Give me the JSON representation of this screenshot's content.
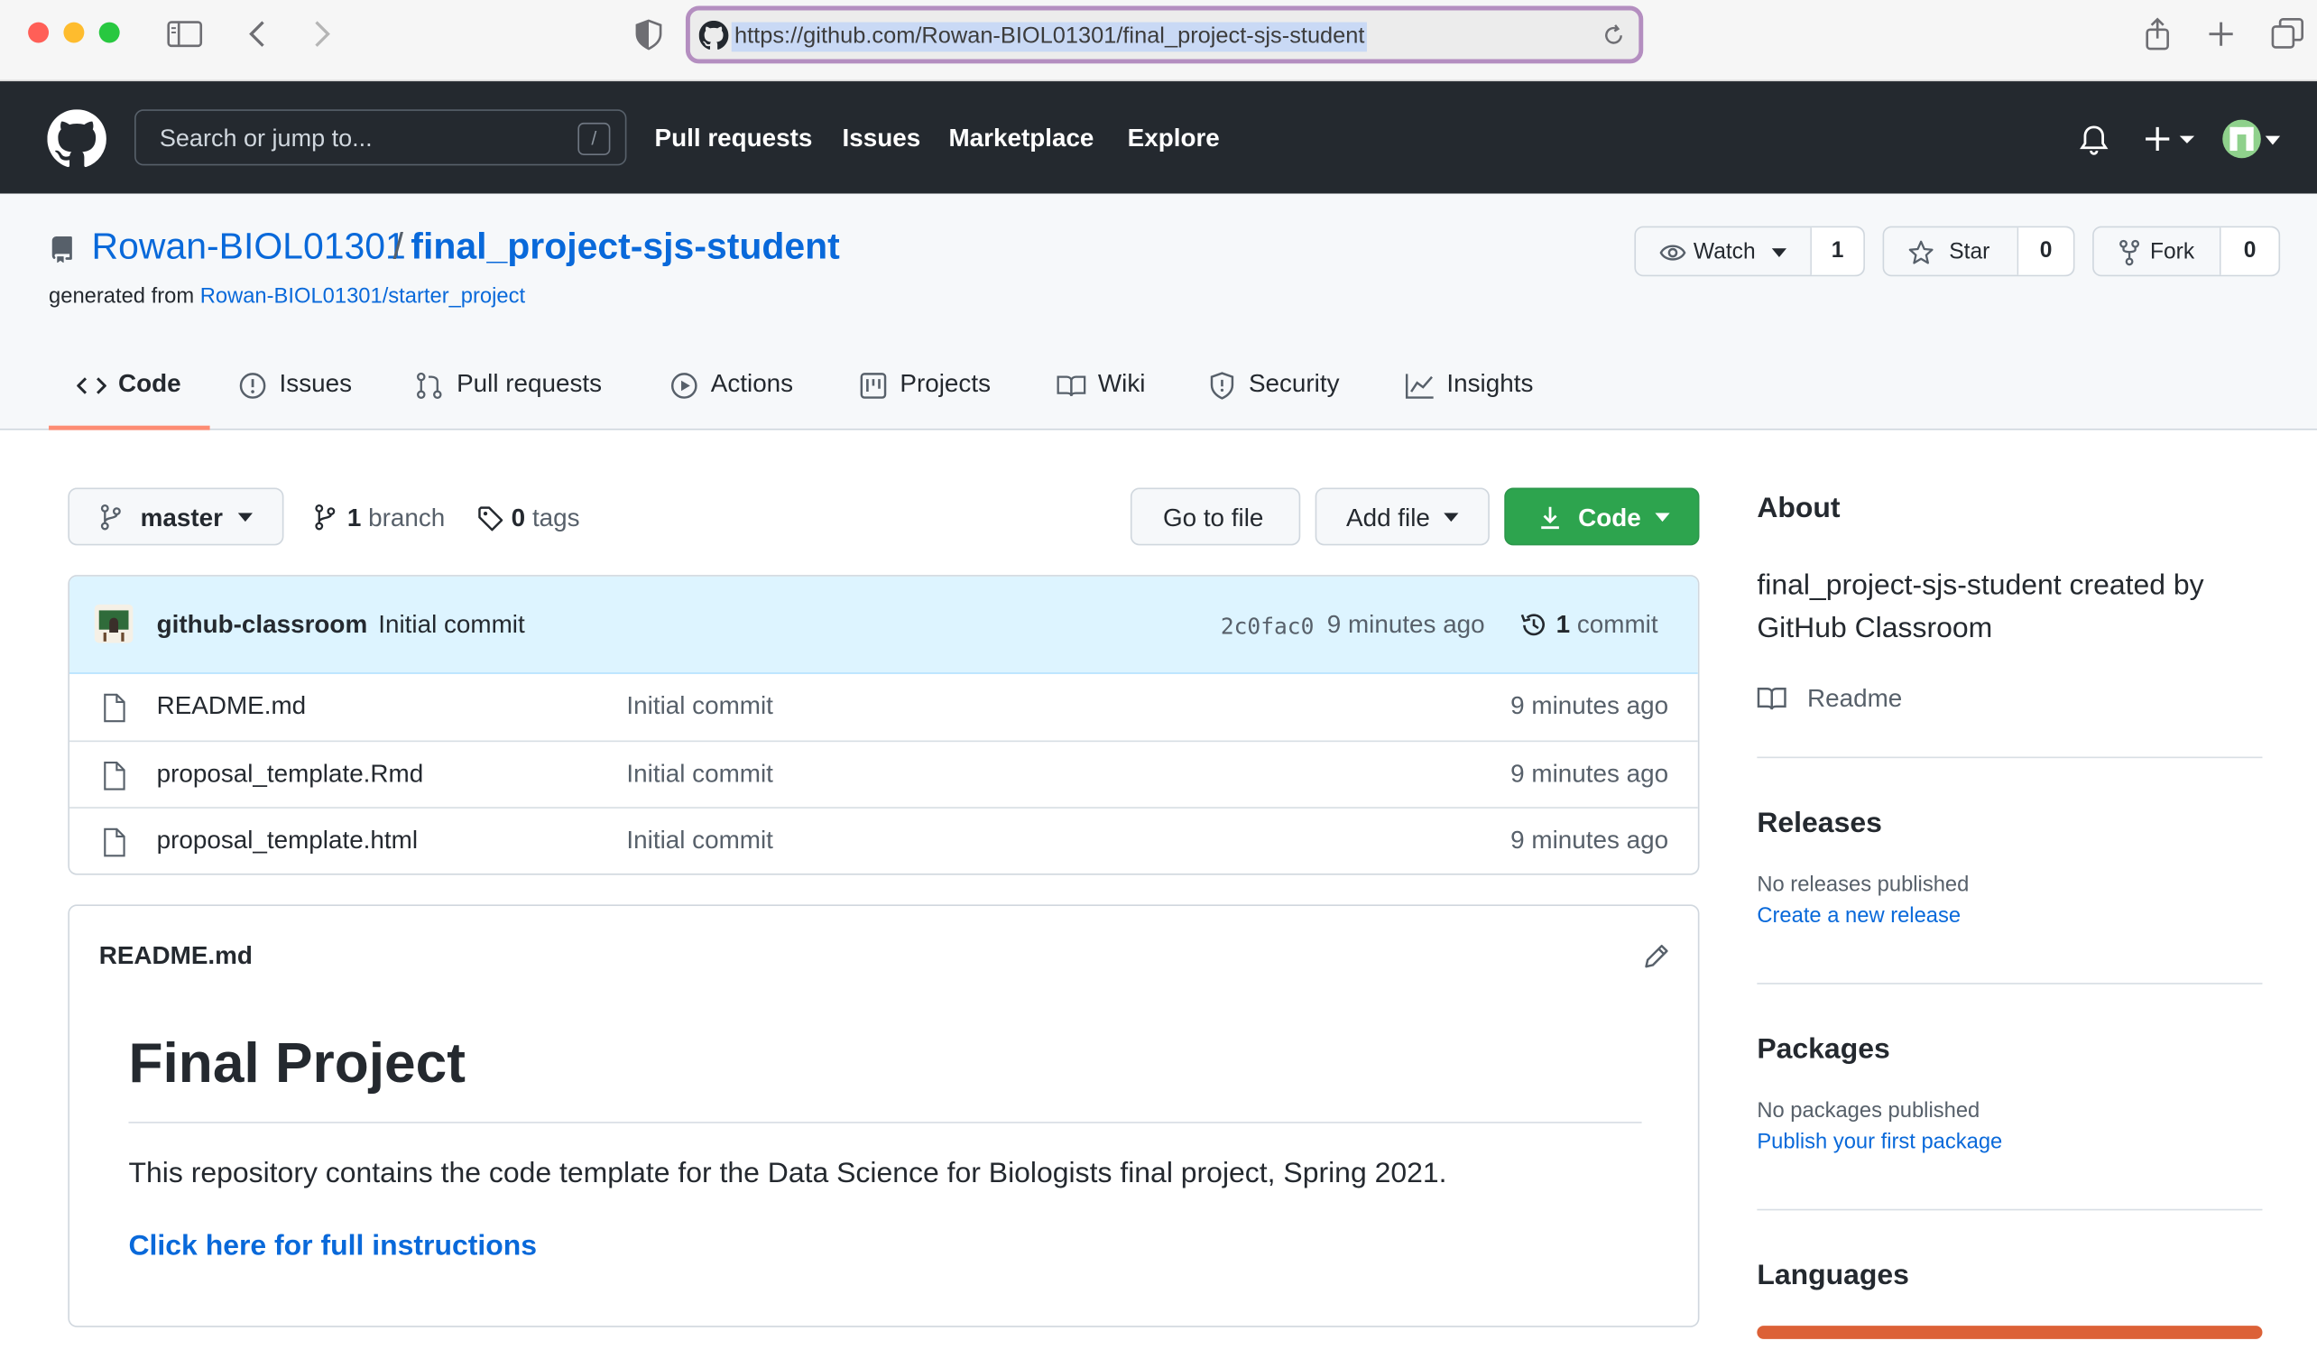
{
  "browser": {
    "url": "https://github.com/Rowan-BIOL01301/final_project-sjs-student"
  },
  "header": {
    "search_placeholder": "Search or jump to...",
    "search_shortcut": "/",
    "nav": [
      "Pull requests",
      "Issues",
      "Marketplace",
      "Explore"
    ]
  },
  "repo": {
    "owner": "Rowan-BIOL01301",
    "separator": "/",
    "name": "final_project-sjs-student",
    "generated_prefix": "generated from",
    "generated_link": "Rowan-BIOL01301/starter_project",
    "watch_label": "Watch",
    "watch_count": "1",
    "star_label": "Star",
    "star_count": "0",
    "fork_label": "Fork",
    "fork_count": "0"
  },
  "tabs": [
    {
      "label": "Code",
      "icon": "code-icon"
    },
    {
      "label": "Issues",
      "icon": "issue-icon"
    },
    {
      "label": "Pull requests",
      "icon": "pull-request-icon"
    },
    {
      "label": "Actions",
      "icon": "play-icon"
    },
    {
      "label": "Projects",
      "icon": "project-icon"
    },
    {
      "label": "Wiki",
      "icon": "book-icon"
    },
    {
      "label": "Security",
      "icon": "shield-icon"
    },
    {
      "label": "Insights",
      "icon": "graph-icon"
    }
  ],
  "toolbar": {
    "branch": "master",
    "branch_count": "1",
    "branch_word": "branch",
    "tag_count": "0",
    "tag_word": "tags",
    "go_to_file": "Go to file",
    "add_file": "Add file",
    "code": "Code"
  },
  "commit": {
    "author": "github-classroom",
    "message": "Initial commit",
    "sha": "2c0fac0",
    "time": "9 minutes ago",
    "count": "1",
    "count_word": "commit"
  },
  "files": [
    {
      "name": "README.md",
      "message": "Initial commit",
      "time": "9 minutes ago"
    },
    {
      "name": "proposal_template.Rmd",
      "message": "Initial commit",
      "time": "9 minutes ago"
    },
    {
      "name": "proposal_template.html",
      "message": "Initial commit",
      "time": "9 minutes ago"
    }
  ],
  "readme": {
    "filename": "README.md",
    "title": "Final Project",
    "body": "This repository contains the code template for the Data Science for Biologists final project, Spring 2021.",
    "link": "Click here for full instructions"
  },
  "sidebar": {
    "about_heading": "About",
    "about_text": "final_project-sjs-student created by GitHub Classroom",
    "readme_label": "Readme",
    "releases_heading": "Releases",
    "releases_text": "No releases published",
    "releases_link": "Create a new release",
    "packages_heading": "Packages",
    "packages_text": "No packages published",
    "packages_link": "Publish your first package",
    "languages_heading": "Languages",
    "language_bar_color": "#dc6137"
  },
  "colors": {
    "accent_link": "#0969da",
    "code_button": "#2da44e",
    "header_bg": "#24292f",
    "tab_underline": "#fd8c73"
  }
}
